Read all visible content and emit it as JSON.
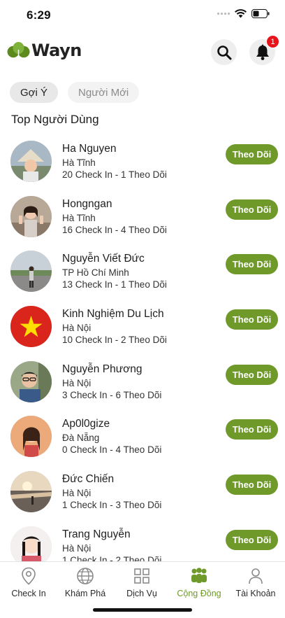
{
  "status_bar": {
    "time": "6:29"
  },
  "header": {
    "logo_text": "Wayn",
    "notification_count": "1",
    "accent_color": "#6f9a2a"
  },
  "tabs": [
    {
      "label": "Gợi Ý",
      "active": true
    },
    {
      "label": "Người Mới",
      "active": false
    }
  ],
  "section_title": "Top Người Dùng",
  "users": [
    {
      "name": "Ha Nguyen",
      "location": "Hà Tĩnh",
      "stats": "20 Check In - 1 Theo Dõi",
      "action": "Theo Dõi"
    },
    {
      "name": "Hongngan",
      "location": "Hà Tĩnh",
      "stats": "16 Check In - 4 Theo Dõi",
      "action": "Theo Dõi"
    },
    {
      "name": "Nguyễn Viết Đức",
      "location": "TP Hồ Chí Minh",
      "stats": "13 Check In - 1 Theo Dõi",
      "action": "Theo Dõi"
    },
    {
      "name": "Kinh Nghiệm Du Lịch",
      "location": "Hà Nội",
      "stats": "10 Check In - 2 Theo Dõi",
      "action": "Theo Dõi"
    },
    {
      "name": "Nguyễn Phương",
      "location": "Hà Nội",
      "stats": "3 Check In - 6 Theo Dõi",
      "action": "Theo Dõi"
    },
    {
      "name": "Ap0l0gize",
      "location": "Đà Nẵng",
      "stats": "0 Check In - 4 Theo Dõi",
      "action": "Theo Dõi"
    },
    {
      "name": "Đức Chiến",
      "location": "Hà Nội",
      "stats": "1 Check In - 3 Theo Dõi",
      "action": "Theo Dõi"
    },
    {
      "name": "Trang Nguyễn",
      "location": "Hà Nội",
      "stats": "1 Check In - 2 Theo Dõi",
      "action": "Theo Dõi"
    }
  ],
  "bottom_nav": [
    {
      "label": "Check In",
      "icon": "location-pin-icon",
      "active": false
    },
    {
      "label": "Khám Phá",
      "icon": "globe-icon",
      "active": false
    },
    {
      "label": "Dịch Vụ",
      "icon": "grid-icon",
      "active": false
    },
    {
      "label": "Cộng Đồng",
      "icon": "community-icon",
      "active": true
    },
    {
      "label": "Tài Khoản",
      "icon": "person-icon",
      "active": false
    }
  ]
}
